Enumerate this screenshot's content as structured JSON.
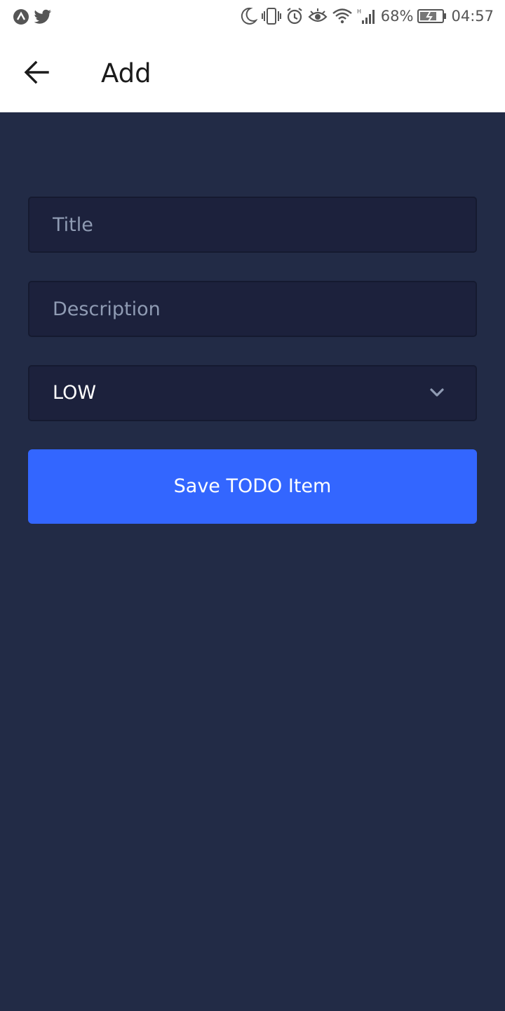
{
  "status_bar": {
    "battery_percent": "68%",
    "time": "04:57",
    "icons": [
      "app-a-icon",
      "twitter-icon",
      "moon-icon",
      "vibrate-icon",
      "alarm-icon",
      "eye-icon",
      "wifi-icon",
      "signal-icon",
      "battery-charging-icon"
    ]
  },
  "app_bar": {
    "title": "Add",
    "back_icon": "arrow-left-icon"
  },
  "form": {
    "title_placeholder": "Title",
    "description_placeholder": "Description",
    "priority_value": "LOW",
    "save_label": "Save TODO Item"
  },
  "colors": {
    "background": "#222b46",
    "input_background": "#1c213c",
    "accent": "#3366ff",
    "placeholder": "#8f9bb3"
  }
}
